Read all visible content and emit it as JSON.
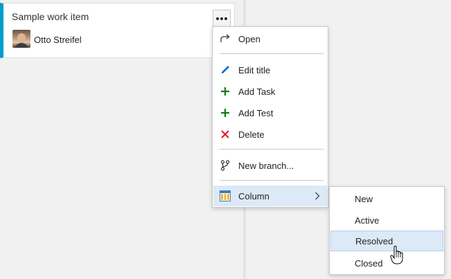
{
  "card": {
    "title": "Sample work item",
    "assignee": "Otto Streifel",
    "accent_color": "#009ccc"
  },
  "context_menu": {
    "items": [
      {
        "label": "Open",
        "icon": "redo-arrow-icon"
      },
      {
        "label": "Edit title",
        "icon": "pencil-icon"
      },
      {
        "label": "Add Task",
        "icon": "plus-icon"
      },
      {
        "label": "Add Test",
        "icon": "plus-icon"
      },
      {
        "label": "Delete",
        "icon": "close-icon"
      },
      {
        "label": "New branch...",
        "icon": "branch-icon"
      },
      {
        "label": "Column",
        "icon": "board-column-icon"
      }
    ]
  },
  "column_submenu": {
    "items": [
      "New",
      "Active",
      "Resolved",
      "Closed"
    ],
    "highlighted": "Resolved"
  },
  "colors": {
    "highlight": "#dce9f6",
    "plus": "#107c10",
    "delete": "#e81123",
    "pencil": "#0078d4"
  }
}
